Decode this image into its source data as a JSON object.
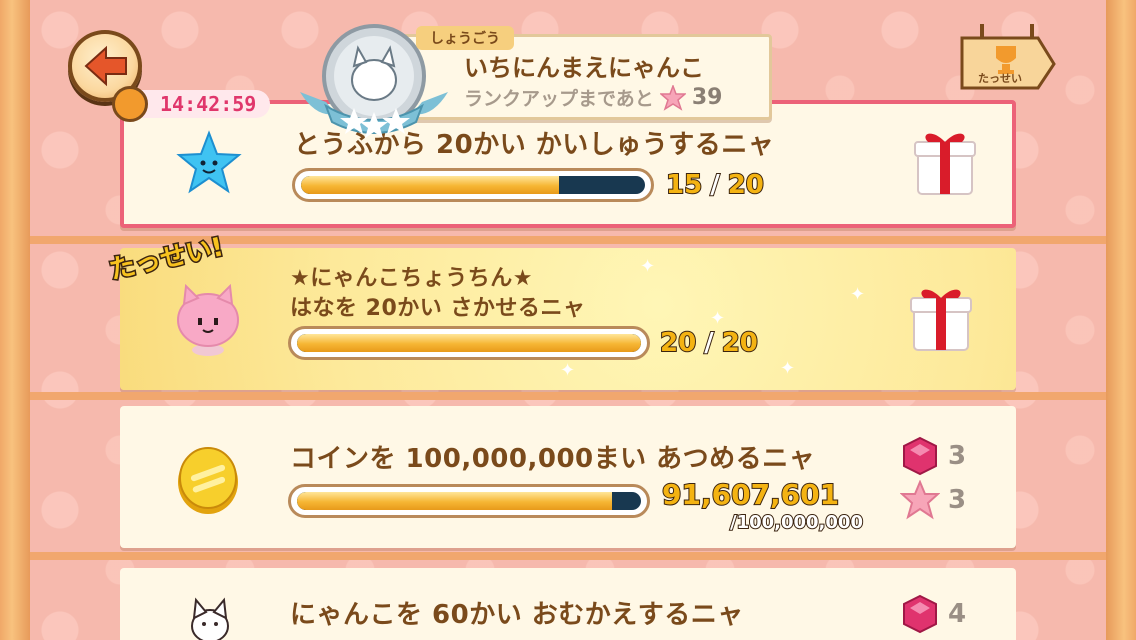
{
  "header": {
    "timer": "14:42:59",
    "rank": {
      "tag": "しょうごう",
      "title": "いちにんまえにゃんこ",
      "subtitle": "ランクアップまであと",
      "stars_needed": "39"
    },
    "achievements_label": "たっせい"
  },
  "missions": [
    {
      "title": "とうふから 20かい かいしゅうするニャ",
      "progress_current": "15",
      "progress_sep": "/",
      "progress_total": "20",
      "progress_fraction": 0.75,
      "icon": "blue-star-icon",
      "reward_icon": "gift-icon"
    },
    {
      "badge": "たっせい!",
      "title_line1": "★にゃんこちょうちん★",
      "title_line2": "はなを 20かい さかせるニャ",
      "progress_current": "20",
      "progress_sep": "/",
      "progress_total": "20",
      "progress_fraction": 1.0,
      "icon": "pink-cat-lantern-icon",
      "reward_icon": "gift-icon"
    },
    {
      "title": "コインを 100,000,000まい あつめるニャ",
      "progress_current": "91,607,601",
      "progress_total": "/100,000,000",
      "progress_fraction": 0.916,
      "icon": "gold-coin-icon",
      "rewards": [
        {
          "icon": "pink-gem-icon",
          "count": "3"
        },
        {
          "icon": "pink-star-icon",
          "count": "3"
        }
      ]
    },
    {
      "title": "にゃんこを 60かい おむかえするニャ",
      "icon": "white-cat-icon",
      "rewards": [
        {
          "icon": "pink-gem-icon",
          "count": "4"
        }
      ]
    }
  ],
  "colors": {
    "brown_text": "#7a4a1b",
    "card_bg": "#fff8e6",
    "timed_border": "#ec6278",
    "bar_fill": "#f6b634",
    "bar_track": "#183850"
  }
}
